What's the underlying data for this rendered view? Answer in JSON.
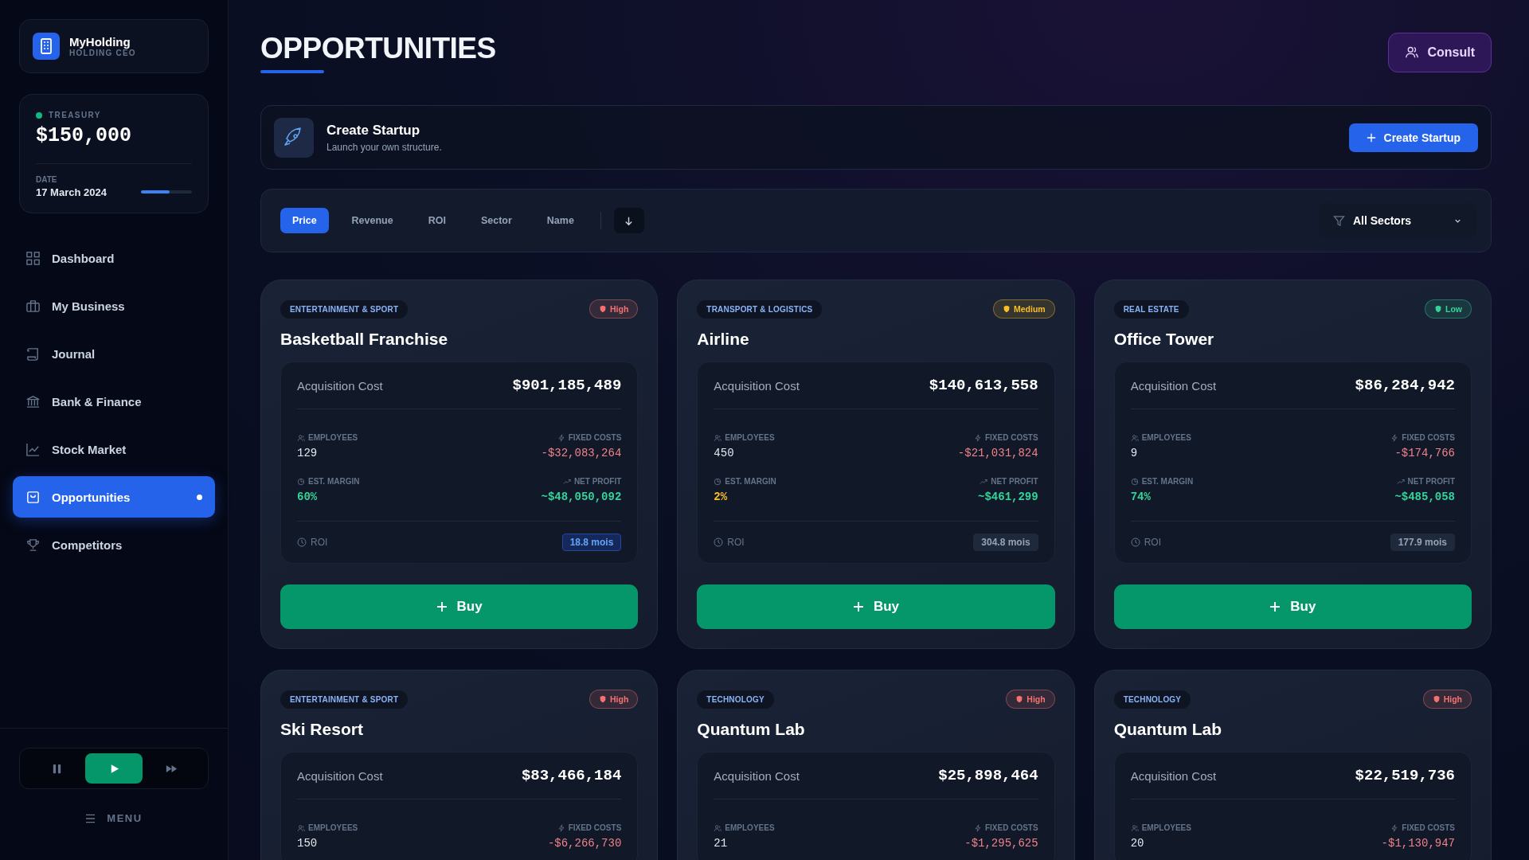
{
  "brand": {
    "name": "MyHolding",
    "subtitle": "HOLDING CEO"
  },
  "treasury": {
    "label": "TREASURY",
    "amount": "$150,000",
    "date_label": "DATE",
    "date": "17 March 2024",
    "level": 0.57
  },
  "nav": [
    {
      "label": "Dashboard",
      "kind": "grid",
      "selected": false
    },
    {
      "label": "My Business",
      "kind": "briefcase",
      "selected": false
    },
    {
      "label": "Journal",
      "kind": "scroll",
      "selected": false
    },
    {
      "label": "Bank & Finance",
      "kind": "bank",
      "selected": false
    },
    {
      "label": "Stock Market",
      "kind": "chart",
      "selected": false
    },
    {
      "label": "Opportunities",
      "kind": "bag",
      "selected": true
    },
    {
      "label": "Competitors",
      "kind": "trophy",
      "selected": false
    }
  ],
  "playback": [
    {
      "kind": "pause",
      "selected": false
    },
    {
      "kind": "play",
      "selected": true
    },
    {
      "kind": "fast",
      "selected": false
    }
  ],
  "menu": {
    "label": "MENU"
  },
  "page": {
    "title": "OPPORTUNITIES",
    "consult": "Consult"
  },
  "startup": {
    "title": "Create Startup",
    "subtitle": "Launch your own structure.",
    "button": "Create Startup"
  },
  "sort_tabs": [
    {
      "label": "Price",
      "selected": true
    },
    {
      "label": "Revenue",
      "selected": false
    },
    {
      "label": "ROI",
      "selected": false
    },
    {
      "label": "Sector",
      "selected": false
    },
    {
      "label": "Name",
      "selected": false
    }
  ],
  "sector_filter": {
    "value": "All Sectors"
  },
  "cards": [
    {
      "category": "ENTERTAINMENT & SPORT",
      "risk": {
        "label": "High",
        "color": "#f87171"
      },
      "name": "Basketball Franchise",
      "cost_label": "Acquisition Cost",
      "cost": "$901,185,489",
      "employees_label": "EMPLOYEES",
      "employees": "129",
      "fixed_label": "FIXED COSTS",
      "fixed": "-$32,083,264",
      "margin_label": "EST. MARGIN",
      "margin": {
        "value": "60%",
        "color": "#34d399"
      },
      "profit_label": "NET PROFIT",
      "profit": "~$48,050,092",
      "roi_label": "ROI",
      "roi": "18.8 mois",
      "roi_highlight": true,
      "buy": "Buy"
    },
    {
      "category": "TRANSPORT & LOGISTICS",
      "risk": {
        "label": "Medium",
        "color": "#fbbf24"
      },
      "name": "Airline",
      "cost_label": "Acquisition Cost",
      "cost": "$140,613,558",
      "employees_label": "EMPLOYEES",
      "employees": "450",
      "fixed_label": "FIXED COSTS",
      "fixed": "-$21,031,824",
      "margin_label": "EST. MARGIN",
      "margin": {
        "value": "2%",
        "color": "#fbbf24"
      },
      "profit_label": "NET PROFIT",
      "profit": "~$461,299",
      "roi_label": "ROI",
      "roi": "304.8 mois",
      "roi_highlight": false,
      "buy": "Buy"
    },
    {
      "category": "REAL ESTATE",
      "risk": {
        "label": "Low",
        "color": "#34d399"
      },
      "name": "Office Tower",
      "cost_label": "Acquisition Cost",
      "cost": "$86,284,942",
      "employees_label": "EMPLOYEES",
      "employees": "9",
      "fixed_label": "FIXED COSTS",
      "fixed": "-$174,766",
      "margin_label": "EST. MARGIN",
      "margin": {
        "value": "74%",
        "color": "#34d399"
      },
      "profit_label": "NET PROFIT",
      "profit": "~$485,058",
      "roi_label": "ROI",
      "roi": "177.9 mois",
      "roi_highlight": false,
      "buy": "Buy"
    },
    {
      "category": "ENTERTAINMENT & SPORT",
      "risk": {
        "label": "High",
        "color": "#f87171"
      },
      "name": "Ski Resort",
      "cost_label": "Acquisition Cost",
      "cost": "$83,466,184",
      "employees_label": "EMPLOYEES",
      "employees": "150",
      "fixed_label": "FIXED COSTS",
      "fixed": "-$6,266,730"
    },
    {
      "category": "TECHNOLOGY",
      "risk": {
        "label": "High",
        "color": "#f87171"
      },
      "name": "Quantum Lab",
      "cost_label": "Acquisition Cost",
      "cost": "$25,898,464",
      "employees_label": "EMPLOYEES",
      "employees": "21",
      "fixed_label": "FIXED COSTS",
      "fixed": "-$1,295,625"
    },
    {
      "category": "TECHNOLOGY",
      "risk": {
        "label": "High",
        "color": "#f87171"
      },
      "name": "Quantum Lab",
      "cost_label": "Acquisition Cost",
      "cost": "$22,519,736",
      "employees_label": "EMPLOYEES",
      "employees": "20",
      "fixed_label": "FIXED COSTS",
      "fixed": "-$1,130,947"
    }
  ]
}
